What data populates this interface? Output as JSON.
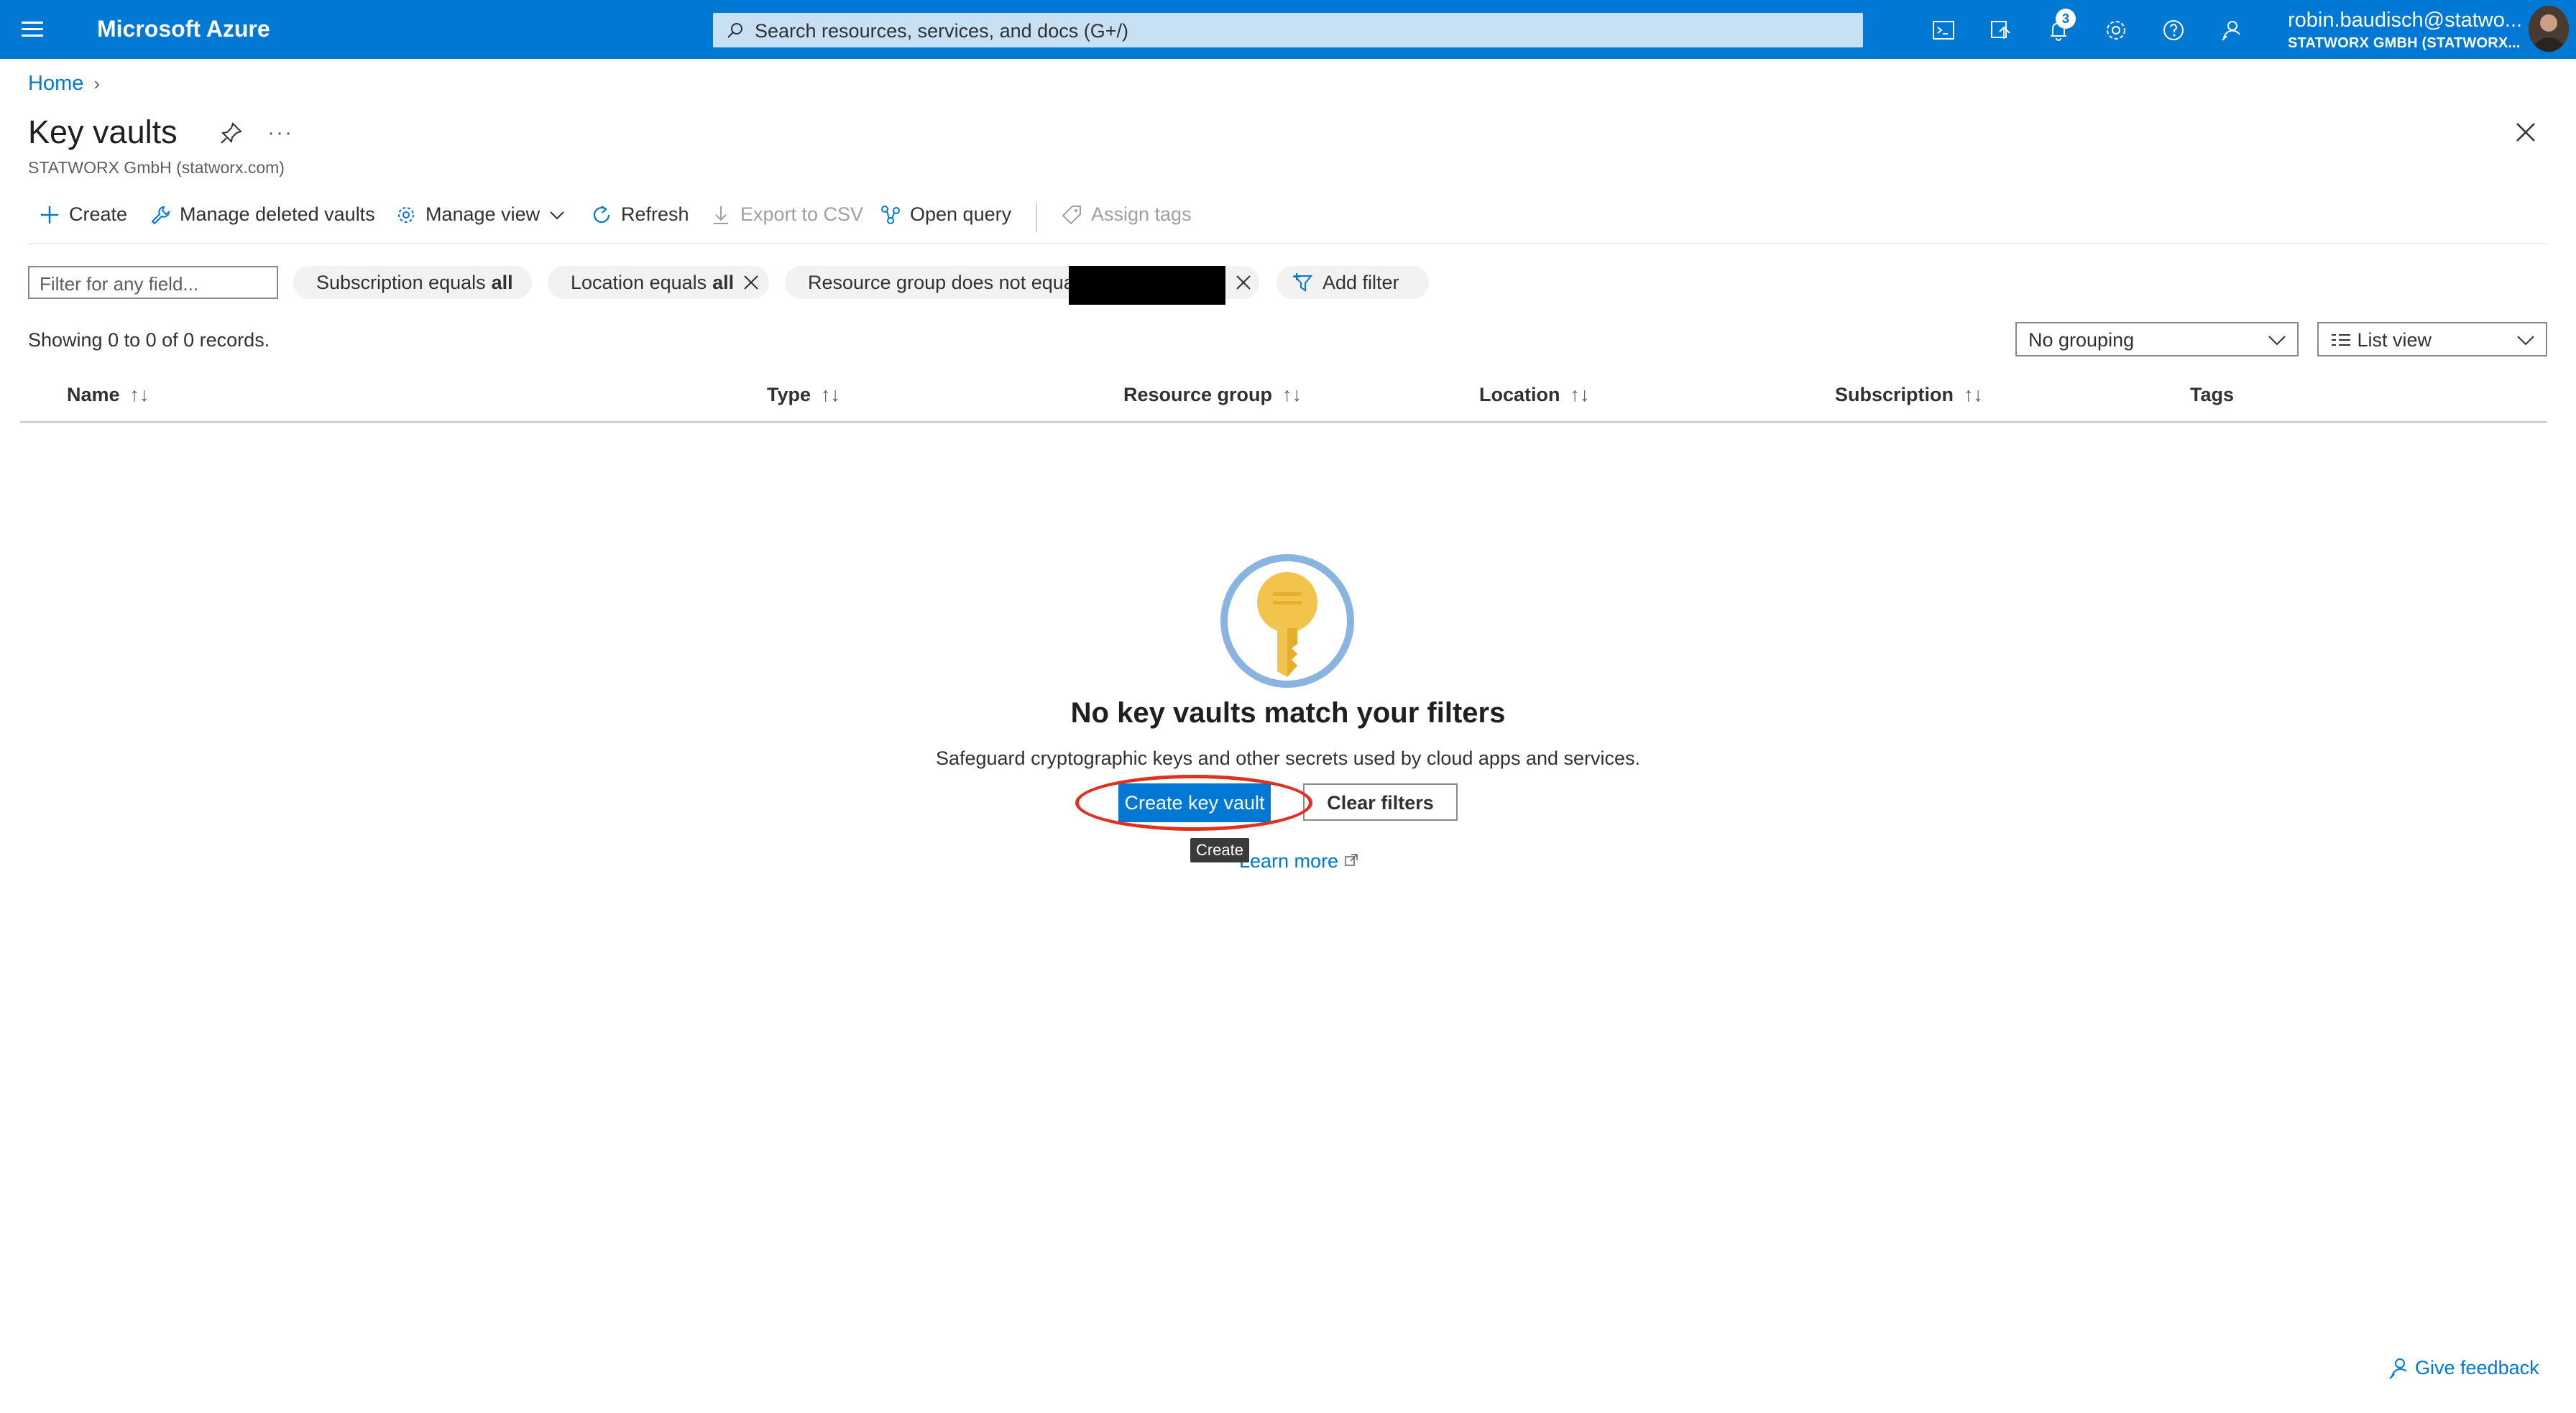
{
  "topbar": {
    "brand": "Microsoft Azure",
    "search_placeholder": "Search resources, services, and docs (G+/)",
    "notification_count": "3",
    "user_email": "robin.baudisch@statwo...",
    "user_org": "STATWORX GMBH (STATWORX...",
    "icons": [
      "cloud-shell-icon",
      "directory-filter-icon",
      "notifications-icon",
      "settings-icon",
      "help-icon",
      "feedback-icon"
    ]
  },
  "breadcrumb": {
    "home": "Home"
  },
  "header": {
    "title": "Key vaults",
    "subtitle": "STATWORX GmbH (statworx.com)",
    "more": "···"
  },
  "toolbar": {
    "create": "Create",
    "manage_deleted": "Manage deleted vaults",
    "manage_view": "Manage view",
    "refresh": "Refresh",
    "export_csv": "Export to CSV",
    "open_query": "Open query",
    "assign_tags": "Assign tags"
  },
  "filters": {
    "placeholder": "Filter for any field...",
    "subscription_label": "Subscription equals",
    "subscription_value": "all",
    "location_label": "Location equals",
    "location_value": "all",
    "resource_group_label": "Resource group does not equal",
    "add_filter": "Add filter"
  },
  "records": "Showing 0 to 0 of 0 records.",
  "grouping": "No grouping",
  "view": "List view",
  "columns": {
    "name": "Name",
    "type": "Type",
    "resource_group": "Resource group",
    "location": "Location",
    "subscription": "Subscription",
    "tags": "Tags"
  },
  "sort_glyph": "↑↓",
  "empty": {
    "title": "No key vaults match your filters",
    "description": "Safeguard cryptographic keys and other secrets used by cloud apps and services.",
    "create_button": "Create key vault",
    "clear_button": "Clear filters",
    "tooltip": "Create",
    "learn_more": "Learn more"
  },
  "feedback": "Give feedback",
  "colors": {
    "accent": "#0078d4",
    "annotation": "#e0301e"
  }
}
